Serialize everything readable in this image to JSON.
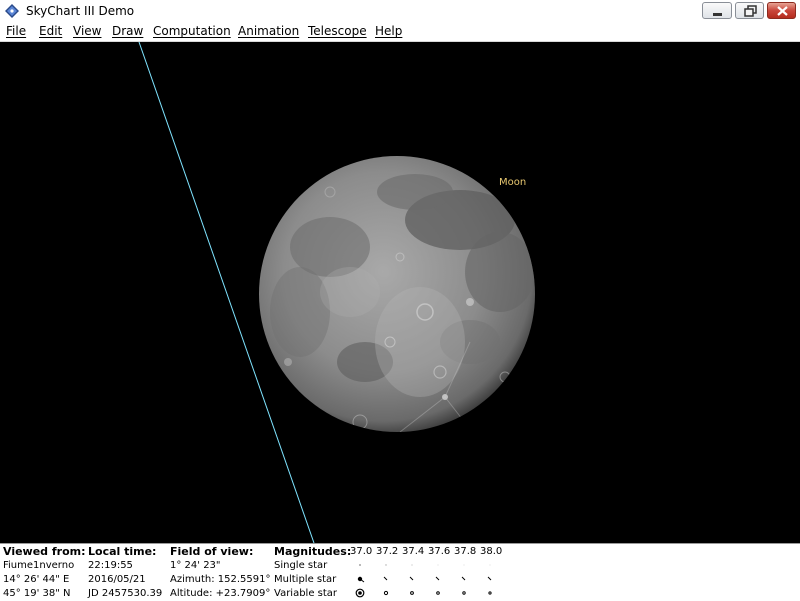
{
  "window": {
    "title": "SkyChart III Demo",
    "icon": "skychart-app-icon",
    "controls": [
      "minimize-icon",
      "maximize-icon",
      "close-icon"
    ]
  },
  "menu": {
    "file": "File",
    "edit": "Edit",
    "view": "View",
    "draw": "Draw",
    "computation": "Computation",
    "animation": "Animation",
    "telescope": "Telescope",
    "help": "Help"
  },
  "sky": {
    "object_label": "Moon",
    "background_color": "#000000",
    "horizon_line_color": "#7fe4ff",
    "label_color": "#e8c870"
  },
  "status": {
    "viewed_from": {
      "header": "Viewed from:",
      "location": "Fiume1nverno",
      "longitude": "14° 26' 44\" E",
      "latitude": "45° 19' 38\" N"
    },
    "local_time": {
      "header": "Local time:",
      "time": "22:19:55",
      "date": "2016/05/21",
      "jd": "JD 2457530.39"
    },
    "field_of_view": {
      "header": "Field of view:",
      "fov": "1° 24' 23\"",
      "azimuth": "Azimuth: 152.5591°",
      "altitude": "Altitude: +23.7909°"
    },
    "magnitudes": {
      "header": "Magnitudes:",
      "values": [
        "37.0",
        "37.2",
        "37.4",
        "37.6",
        "37.8",
        "38.0"
      ],
      "legend": [
        "Single star",
        "Multiple star",
        "Variable star"
      ]
    }
  }
}
